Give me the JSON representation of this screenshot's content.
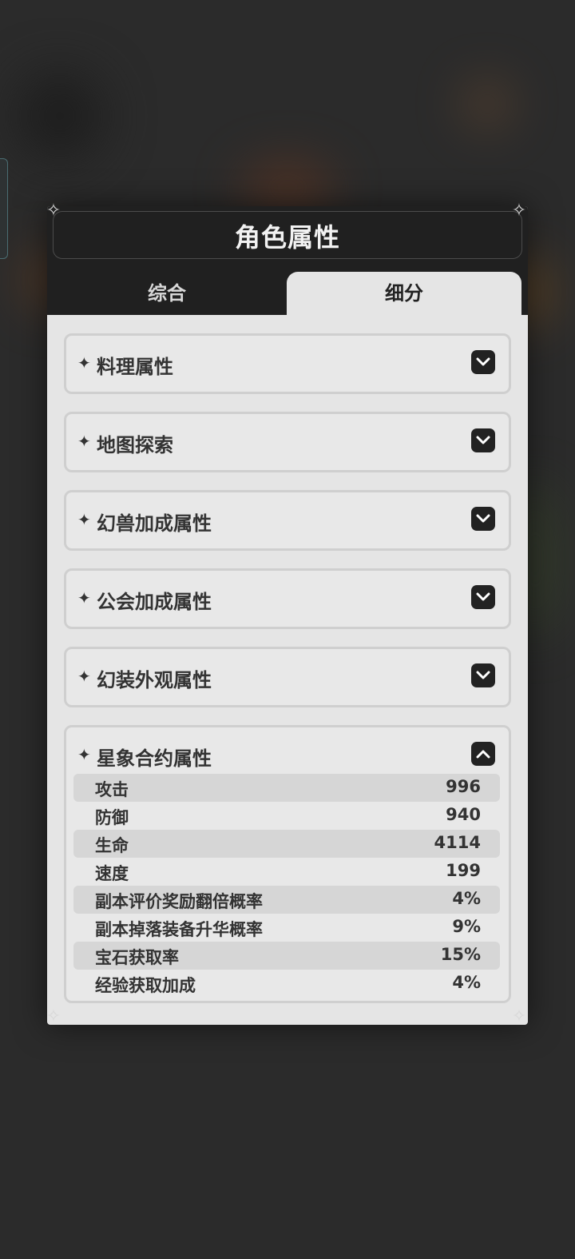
{
  "modal": {
    "title": "角色属性",
    "tabs": [
      {
        "label": "综合",
        "active": false
      },
      {
        "label": "细分",
        "active": true
      }
    ]
  },
  "sections": [
    {
      "title": "料理属性",
      "expanded": false
    },
    {
      "title": "地图探索",
      "expanded": false
    },
    {
      "title": "幻兽加成属性",
      "expanded": false
    },
    {
      "title": "公会加成属性",
      "expanded": false
    },
    {
      "title": "幻装外观属性",
      "expanded": false
    },
    {
      "title": "星象合约属性",
      "expanded": true,
      "stats": [
        {
          "name": "攻击",
          "value": "996"
        },
        {
          "name": "防御",
          "value": "940"
        },
        {
          "name": "生命",
          "value": "4114"
        },
        {
          "name": "速度",
          "value": "199"
        },
        {
          "name": "副本评价奖励翻倍概率",
          "value": "4%"
        },
        {
          "name": "副本掉落装备升华概率",
          "value": "9%"
        },
        {
          "name": "宝石获取率",
          "value": "15%"
        },
        {
          "name": "经验获取加成",
          "value": "4%"
        }
      ]
    }
  ],
  "icons": {
    "section_bullet": "sparkle-icon",
    "collapsed_toggle": "chevron-down-icon",
    "expanded_toggle": "chevron-up-icon",
    "corner": "corner-ornament-icon"
  },
  "colors": {
    "panel_bg": "#e5e5e5",
    "header_bg": "#202020",
    "toggle_bg": "#222222"
  }
}
